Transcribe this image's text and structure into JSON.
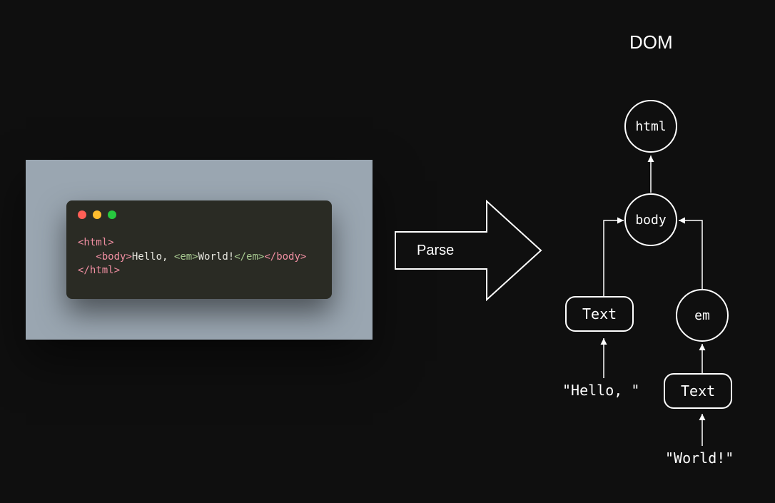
{
  "diagram": {
    "title": "DOM",
    "arrow_label": "Parse"
  },
  "code": {
    "line1": {
      "open": "<html>"
    },
    "line2": {
      "indent": "   ",
      "body_open": "<body>",
      "text1": "Hello, ",
      "em_open": "<em>",
      "text2": "World!",
      "em_close": "</em>",
      "body_close": "</body>"
    },
    "line3": {
      "close": "</html>"
    }
  },
  "dom": {
    "html": "html",
    "body": "body",
    "text_node_1": "Text",
    "em": "em",
    "text_node_2": "Text",
    "hello_value": "\"Hello, \"",
    "world_value": "\"World!\""
  },
  "colors": {
    "bg": "#0f0f0f",
    "panel": "#9aa6b1",
    "code_bg": "#2a2b24",
    "tag_pink": "#f08fa2",
    "tag_green": "#a7c990",
    "red": "#ff5f56",
    "yellow": "#ffbd2e",
    "green": "#27c93f"
  }
}
